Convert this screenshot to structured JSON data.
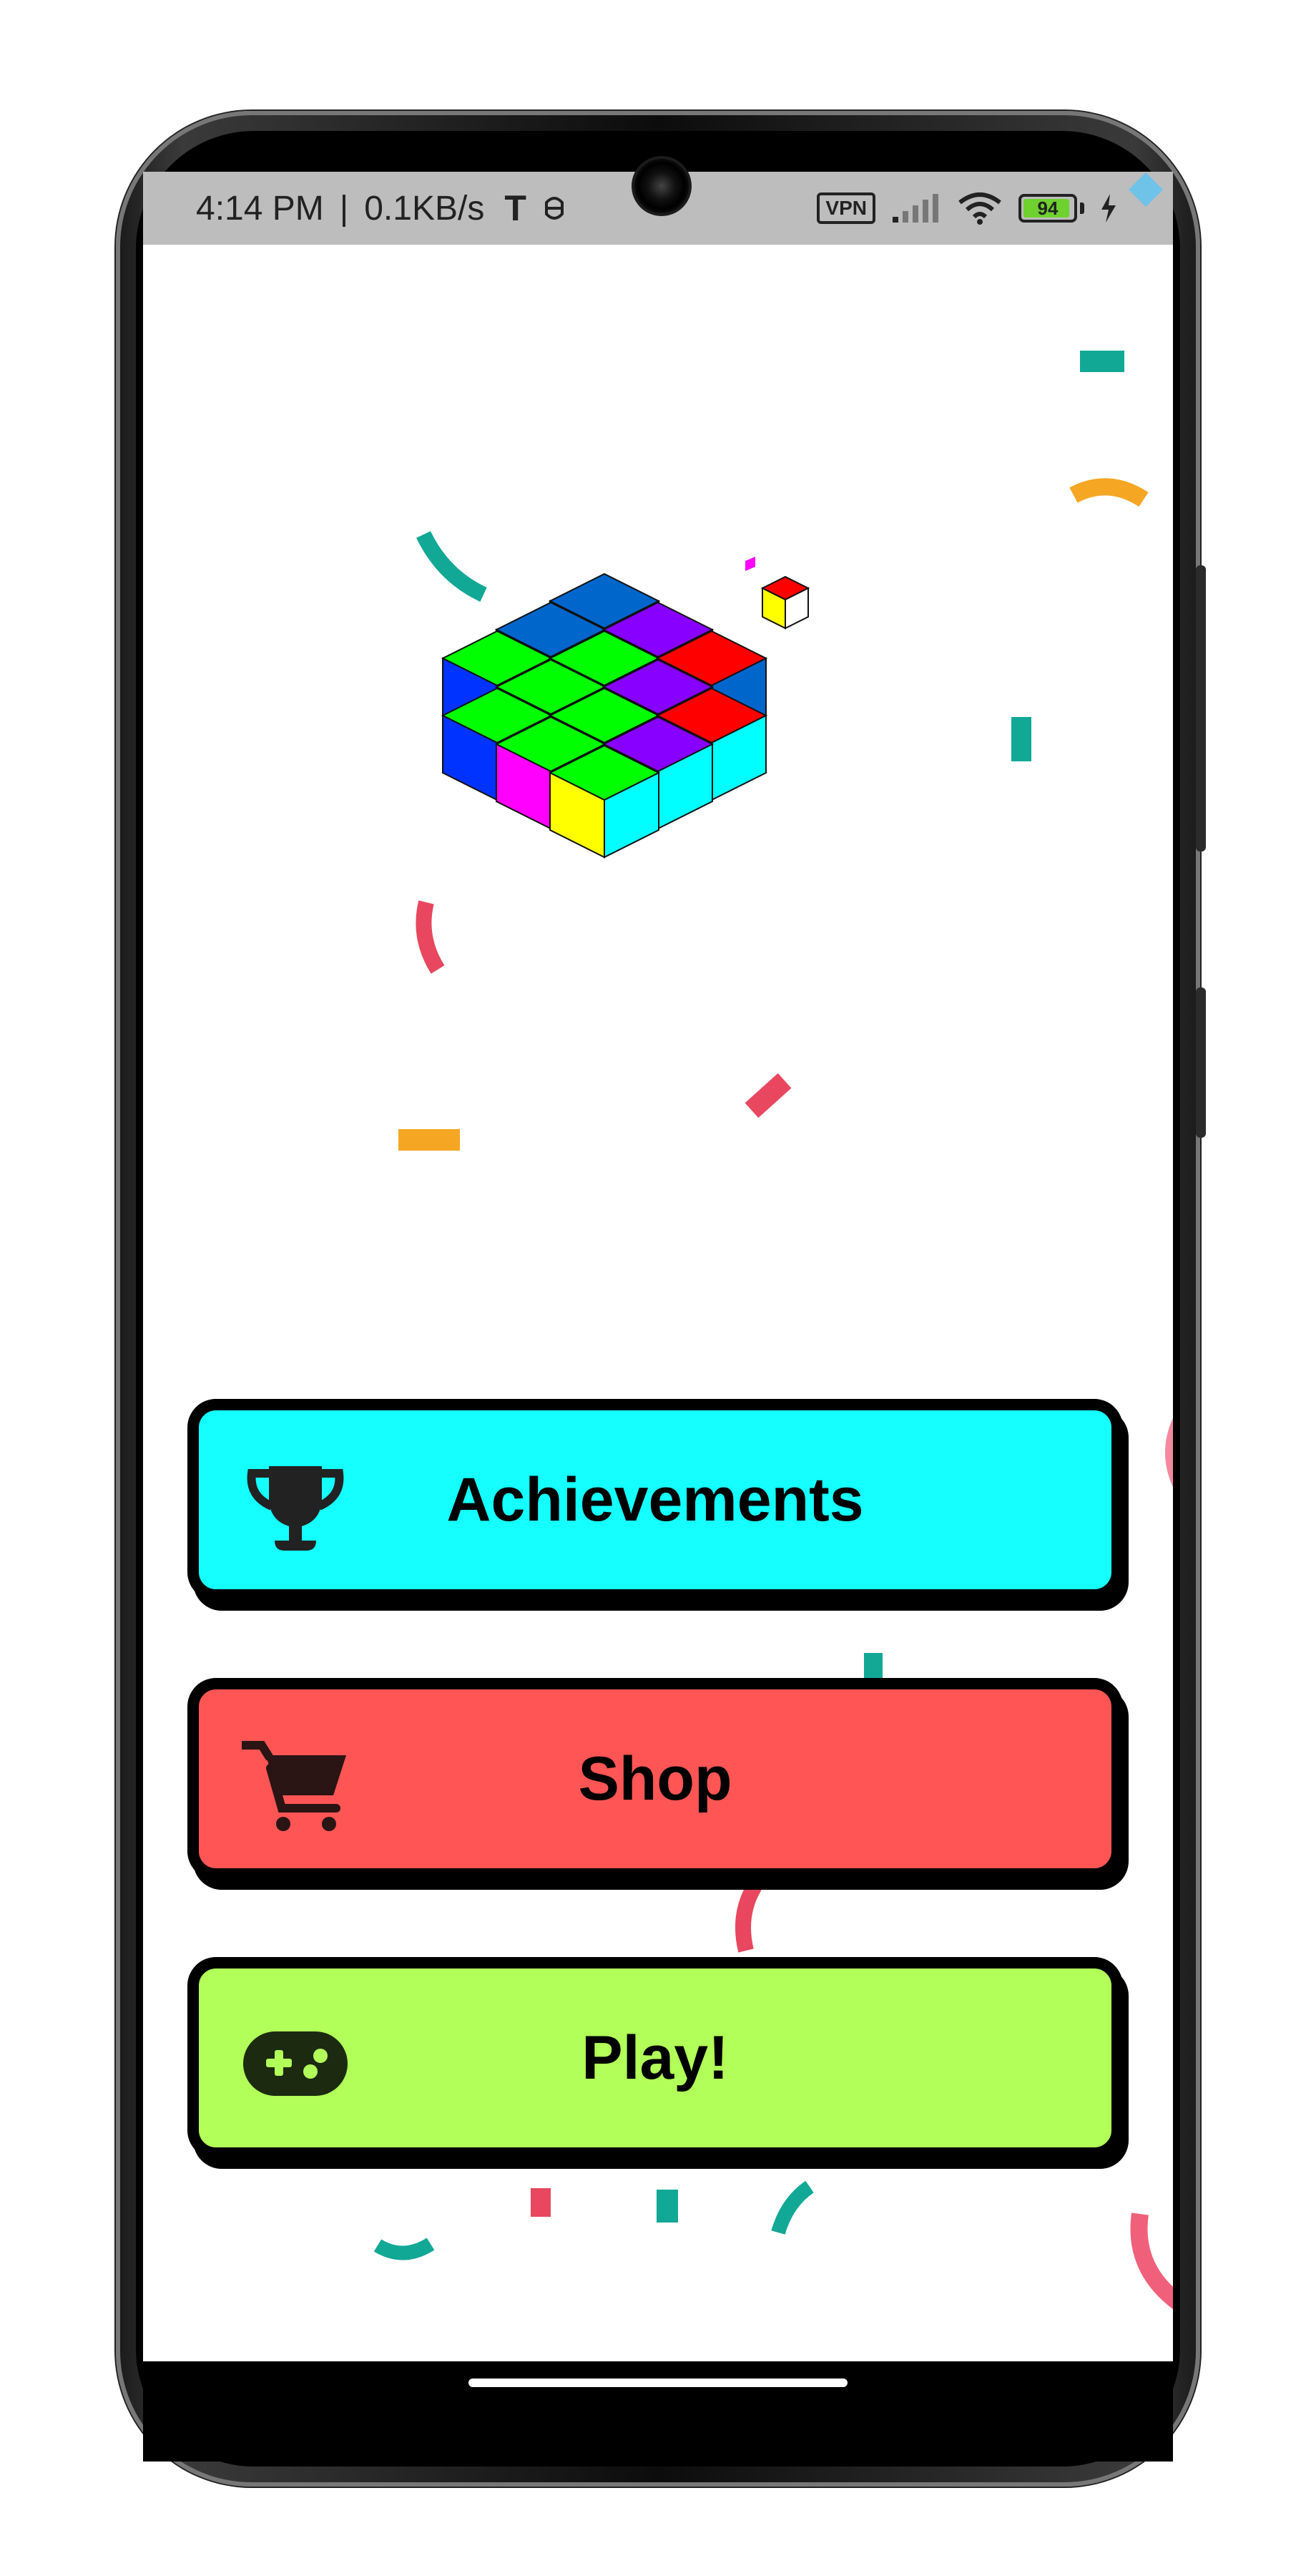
{
  "status_bar": {
    "time": "4:14 PM",
    "separator": "|",
    "network_speed": "0.1KB/s",
    "vpn_label": "VPN",
    "battery_level": "94",
    "battery_fraction": 0.94,
    "icons": [
      "t-app-icon",
      "notification-app-icon",
      "vpn-icon",
      "signal-icon",
      "wifi-icon",
      "battery-icon",
      "charging-icon"
    ]
  },
  "menu": {
    "buttons": [
      {
        "label": "Achievements",
        "icon": "trophy-icon",
        "color": "#15ffff"
      },
      {
        "label": "Shop",
        "icon": "shopping-cart-icon",
        "color": "#ff5555"
      },
      {
        "label": "Play!",
        "icon": "gamepad-icon",
        "color": "#b2ff59"
      }
    ]
  },
  "logo": {
    "icon": "cube-stack-icon"
  },
  "colors": {
    "confetti": [
      "#12a896",
      "#f5a623",
      "#e8475f",
      "#6fc3e8"
    ],
    "cubes": [
      "#0033ff",
      "#0066cc",
      "#00ff00",
      "#ff00ff",
      "#ffff00",
      "#00ffff",
      "#ff0000",
      "#8800ff",
      "#ffffff"
    ]
  }
}
